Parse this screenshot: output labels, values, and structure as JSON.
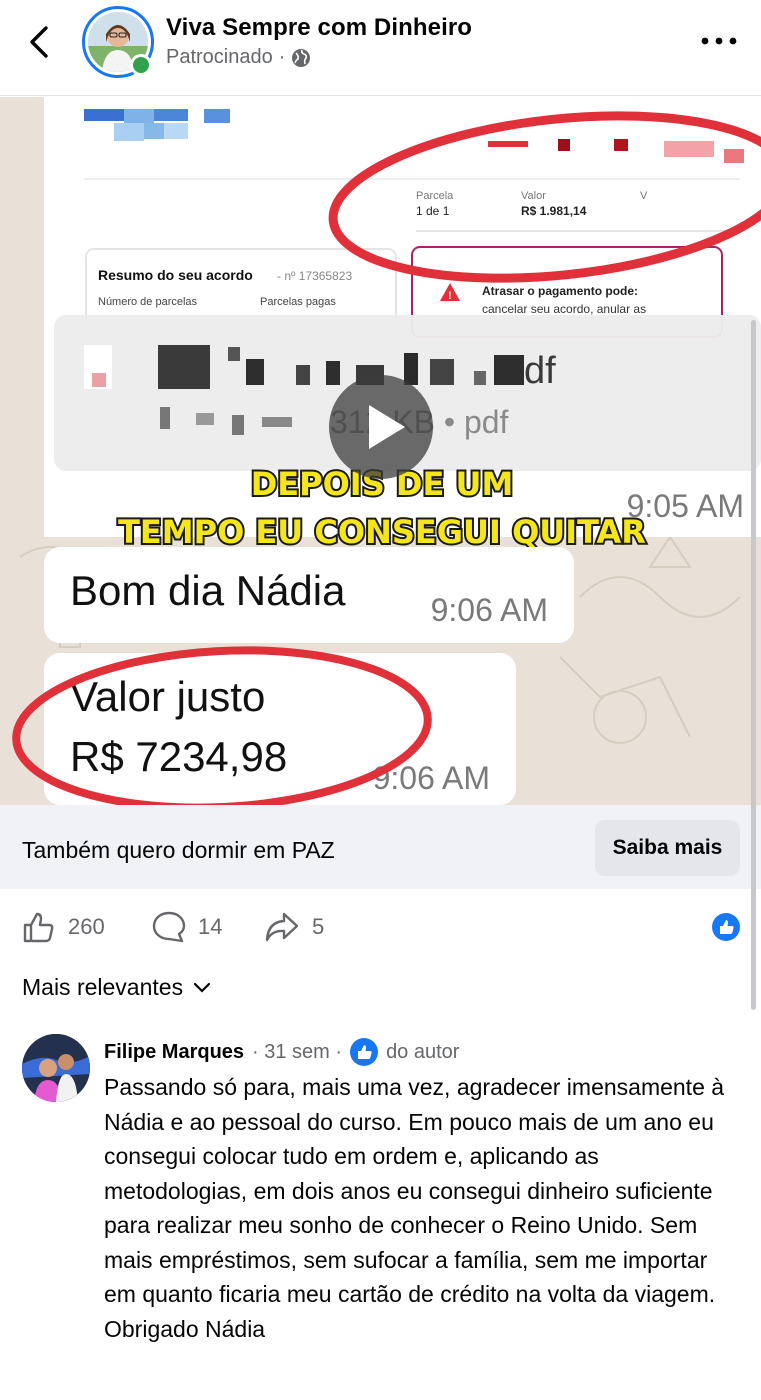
{
  "header": {
    "page_name": "Viva Sempre com Dinheiro",
    "sponsored": "Patrocinado",
    "separator": "·"
  },
  "media": {
    "doc": {
      "col_parcela": "Parcela",
      "col_valor": "Valor",
      "col_v": "V",
      "parcela_value": "1 de 1",
      "valor_value": "R$ 1.981,14",
      "resumo_title": "Resumo do seu acordo",
      "resumo_num": "- nº 17365823",
      "num_parcelas": "Número de parcelas",
      "parcelas_pagas": "Parcelas pagas",
      "atrasar_title": "Atrasar o pagamento pode:",
      "atrasar_text": "cancelar seu acordo, anular as"
    },
    "file_ext": "df",
    "file_size": "312 KB • pdf",
    "time_1": "9:05 AM",
    "caption_line_1": "DEPOIS DE UM",
    "caption_line_2": "TEMPO EU CONSEGUI QUITAR",
    "msg_1": "Bom dia Nádia",
    "msg_1_time": "9:06 AM",
    "msg_2_line_1": "Valor justo",
    "msg_2_line_2": "R$ 7234,98",
    "msg_2_time": "9:06 AM"
  },
  "cta": {
    "text": "Também quero dormir em PAZ",
    "button": "Saiba mais"
  },
  "stats": {
    "likes": "260",
    "comments": "14",
    "shares": "5"
  },
  "sort_label": "Mais relevantes",
  "comment": {
    "name": "Filipe Marques",
    "time": "· 31 sem ·",
    "badge": "do autor",
    "text": "Passando só para, mais uma vez, agradecer imensamente à Nádia e ao pessoal do curso. Em pouco mais de um ano eu consegui colocar tudo em ordem e, aplicando as metodologias, em dois anos eu consegui dinheiro suficiente para realizar meu sonho de conhecer o Reino Unido. Sem mais empréstimos, sem sufocar a família, sem me importar em quanto ficaria meu cartão de crédito na volta da viagem. Obrigado Nádia"
  },
  "colors": {
    "brand_blue": "#1877f2",
    "online_green": "#31a24c",
    "caption_yellow": "#f5e61c",
    "circle_red": "#e0303a",
    "muted": "#65676b"
  },
  "icons": [
    "back-arrow-icon",
    "globe-icon",
    "more-dots-icon",
    "play-icon",
    "like-icon",
    "comment-icon",
    "share-icon",
    "chevron-down-icon",
    "like-badge-icon",
    "warning-icon"
  ]
}
